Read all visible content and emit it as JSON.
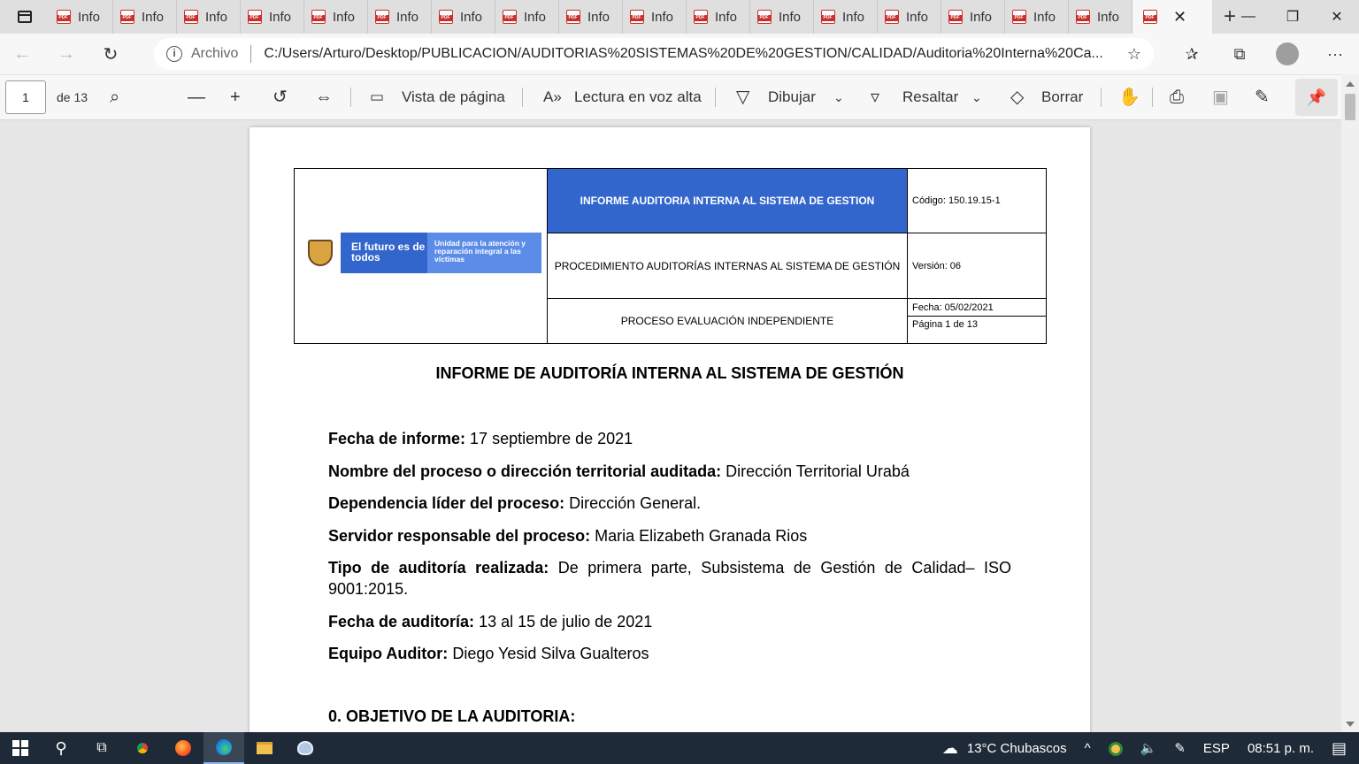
{
  "browser": {
    "tabs": [
      {
        "label": "Info"
      },
      {
        "label": "Info"
      },
      {
        "label": "Info"
      },
      {
        "label": "Info"
      },
      {
        "label": "Info"
      },
      {
        "label": "Info"
      },
      {
        "label": "Info"
      },
      {
        "label": "Info"
      },
      {
        "label": "Info"
      },
      {
        "label": "Info"
      },
      {
        "label": "Info"
      },
      {
        "label": "Info"
      },
      {
        "label": "Info"
      },
      {
        "label": "Info"
      },
      {
        "label": "Info"
      },
      {
        "label": "Info"
      },
      {
        "label": "Info"
      }
    ],
    "active_tab_close": "✕",
    "new_tab": "+",
    "window": {
      "minimize": "—",
      "maximize": "❐",
      "close": "✕"
    }
  },
  "address": {
    "scheme_label": "Archivo",
    "url": "C:/Users/Arturo/Desktop/PUBLICACION/AUDITORIAS%20SISTEMAS%20DE%20GESTION/CALIDAD/Auditoria%20Interna%20Ca..."
  },
  "pdf_toolbar": {
    "page_current": "1",
    "page_total": "de 13",
    "page_view": "Vista de página",
    "read_aloud": "Lectura en voz alta",
    "draw": "Dibujar",
    "highlight": "Resaltar",
    "erase": "Borrar"
  },
  "document": {
    "header": {
      "logo_text_1": "El futuro es de todos",
      "logo_text_2": "Unidad para la atención y reparación integral a las víctimas",
      "title_cell": "INFORME AUDITORIA INTERNA AL SISTEMA DE GESTION",
      "procedure_cell": "PROCEDIMIENTO AUDITORÍAS INTERNAS AL SISTEMA DE GESTIÓN",
      "process_cell": "PROCESO EVALUACIÓN INDEPENDIENTE",
      "code": "Código: 150.19.15-1",
      "version": "Versión: 06",
      "date": "Fecha: 05/02/2021",
      "page": "Página 1 de 13"
    },
    "title": "INFORME DE AUDITORÍA INTERNA AL SISTEMA DE GESTIÓN",
    "fields": [
      {
        "label": "Fecha de informe:",
        "value": "17 septiembre de 2021"
      },
      {
        "label": "Nombre del proceso o dirección territorial auditada:",
        "value": "Dirección Territorial Urabá"
      },
      {
        "label": "Dependencia líder del proceso:",
        "value": "Dirección General."
      },
      {
        "label": "Servidor responsable del proceso:",
        "value": "Maria Elizabeth Granada Rios"
      },
      {
        "label": "Tipo de auditoría realizada:",
        "value": "De primera parte, Subsistema de Gestión de Calidad– ISO 9001:2015."
      },
      {
        "label": "Fecha de auditoría:",
        "value": "13 al 15 de julio de 2021"
      },
      {
        "label": "Equipo Auditor:",
        "value": "Diego Yesid Silva Gualteros"
      }
    ],
    "section_heading": "0.  OBJETIVO DE LA AUDITORIA:"
  },
  "taskbar": {
    "weather": "13°C  Chubascos",
    "language": "ESP",
    "time": "08:51 p. m."
  }
}
